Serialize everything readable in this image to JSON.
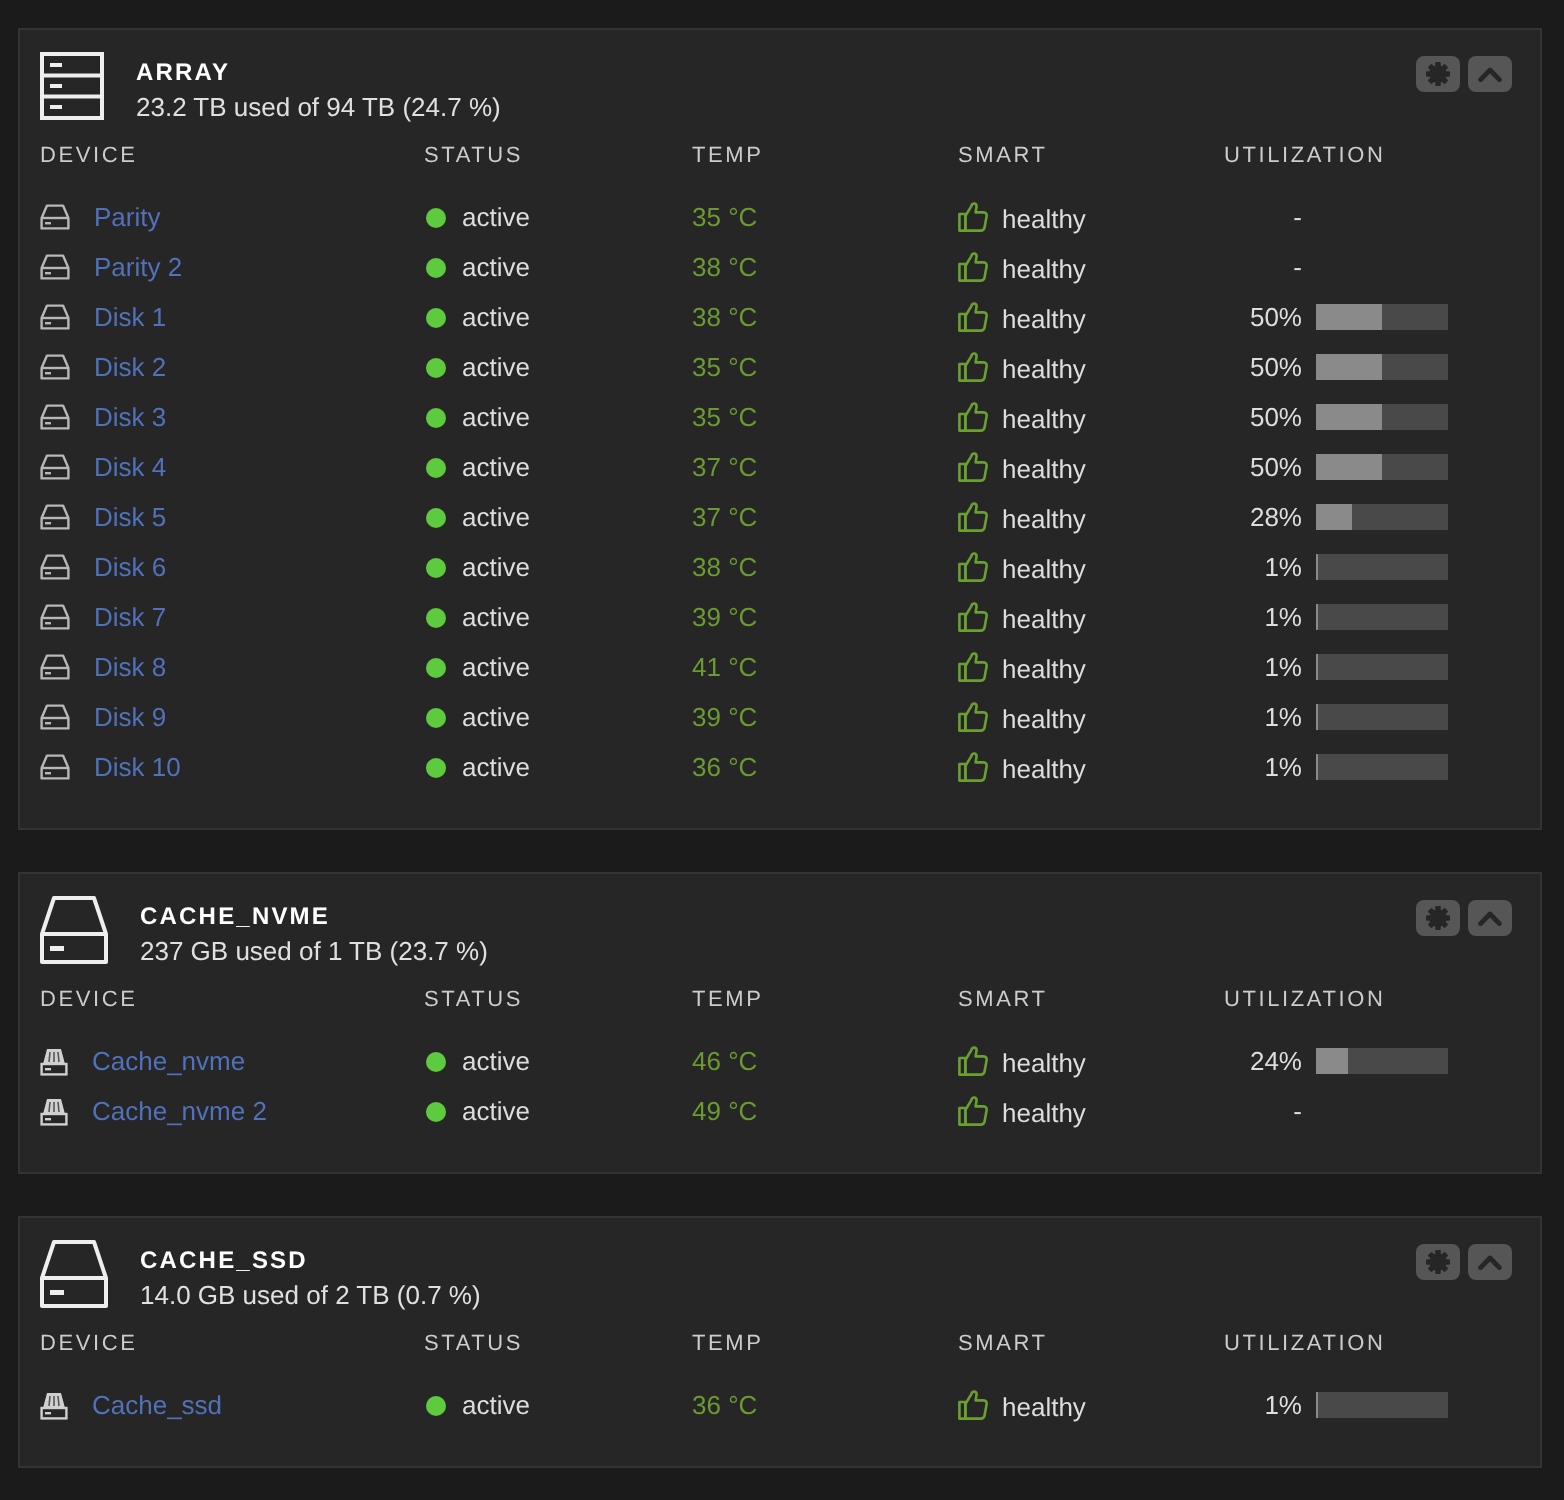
{
  "pools": [
    {
      "kind": "array",
      "title": "ARRAY",
      "usage": "23.2 TB used of 94 TB (24.7 %)",
      "columns": [
        "DEVICE",
        "STATUS",
        "TEMP",
        "SMART",
        "UTILIZATION"
      ],
      "devices": [
        {
          "kind": "hdd",
          "name": "Parity",
          "status": "active",
          "temp": "35 °C",
          "smart": "healthy",
          "utilization": "-"
        },
        {
          "kind": "hdd",
          "name": "Parity 2",
          "status": "active",
          "temp": "38 °C",
          "smart": "healthy",
          "utilization": "-"
        },
        {
          "kind": "hdd",
          "name": "Disk 1",
          "status": "active",
          "temp": "38 °C",
          "smart": "healthy",
          "utilization": "50%",
          "level": 0.5
        },
        {
          "kind": "hdd",
          "name": "Disk 2",
          "status": "active",
          "temp": "35 °C",
          "smart": "healthy",
          "utilization": "50%",
          "level": 0.5
        },
        {
          "kind": "hdd",
          "name": "Disk 3",
          "status": "active",
          "temp": "35 °C",
          "smart": "healthy",
          "utilization": "50%",
          "level": 0.5
        },
        {
          "kind": "hdd",
          "name": "Disk 4",
          "status": "active",
          "temp": "37 °C",
          "smart": "healthy",
          "utilization": "50%",
          "level": 0.5
        },
        {
          "kind": "hdd",
          "name": "Disk 5",
          "status": "active",
          "temp": "37 °C",
          "smart": "healthy",
          "utilization": "28%",
          "level": 0.28
        },
        {
          "kind": "hdd",
          "name": "Disk 6",
          "status": "active",
          "temp": "38 °C",
          "smart": "healthy",
          "utilization": "1%",
          "level": 0.01
        },
        {
          "kind": "hdd",
          "name": "Disk 7",
          "status": "active",
          "temp": "39 °C",
          "smart": "healthy",
          "utilization": "1%",
          "level": 0.01
        },
        {
          "kind": "hdd",
          "name": "Disk 8",
          "status": "active",
          "temp": "41 °C",
          "smart": "healthy",
          "utilization": "1%",
          "level": 0.01
        },
        {
          "kind": "hdd",
          "name": "Disk 9",
          "status": "active",
          "temp": "39 °C",
          "smart": "healthy",
          "utilization": "1%",
          "level": 0.01
        },
        {
          "kind": "hdd",
          "name": "Disk 10",
          "status": "active",
          "temp": "36 °C",
          "smart": "healthy",
          "utilization": "1%",
          "level": 0.01
        }
      ]
    },
    {
      "kind": "cache",
      "title": "CACHE_NVME",
      "usage": "237 GB used of 1 TB (23.7 %)",
      "columns": [
        "DEVICE",
        "STATUS",
        "TEMP",
        "SMART",
        "UTILIZATION"
      ],
      "devices": [
        {
          "kind": "ssd",
          "name": "Cache_nvme",
          "status": "active",
          "temp": "46 °C",
          "smart": "healthy",
          "utilization": "24%",
          "level": 0.24
        },
        {
          "kind": "ssd",
          "name": "Cache_nvme 2",
          "status": "active",
          "temp": "49 °C",
          "smart": "healthy",
          "utilization": "-"
        }
      ]
    },
    {
      "kind": "cache",
      "title": "CACHE_SSD",
      "usage": "14.0 GB used of 2 TB (0.7 %)",
      "columns": [
        "DEVICE",
        "STATUS",
        "TEMP",
        "SMART",
        "UTILIZATION"
      ],
      "devices": [
        {
          "kind": "ssd",
          "name": "Cache_ssd",
          "status": "active",
          "temp": "36 °C",
          "smart": "healthy",
          "utilization": "1%",
          "level": 0.01
        }
      ]
    }
  ]
}
